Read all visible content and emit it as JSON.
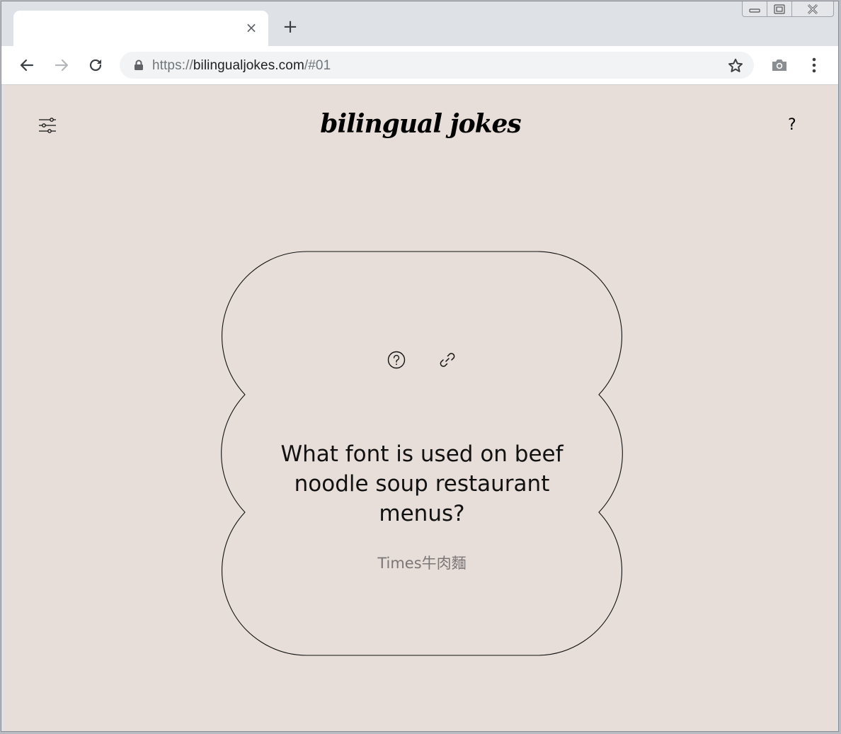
{
  "browser": {
    "tab_close_label": "×",
    "new_tab_label": "+",
    "url_scheme": "https://",
    "url_host": "bilingualjokes.com",
    "url_path": "/#01"
  },
  "site": {
    "logo": "bilingual jokes",
    "help": "?"
  },
  "joke": {
    "question": "What font is used on beef noodle soup restaurant menus?",
    "answer": "Times牛肉麵"
  },
  "colors": {
    "page_background": "#e8ded9",
    "card_outline": "#000000",
    "answer_text": "#7a7676"
  }
}
